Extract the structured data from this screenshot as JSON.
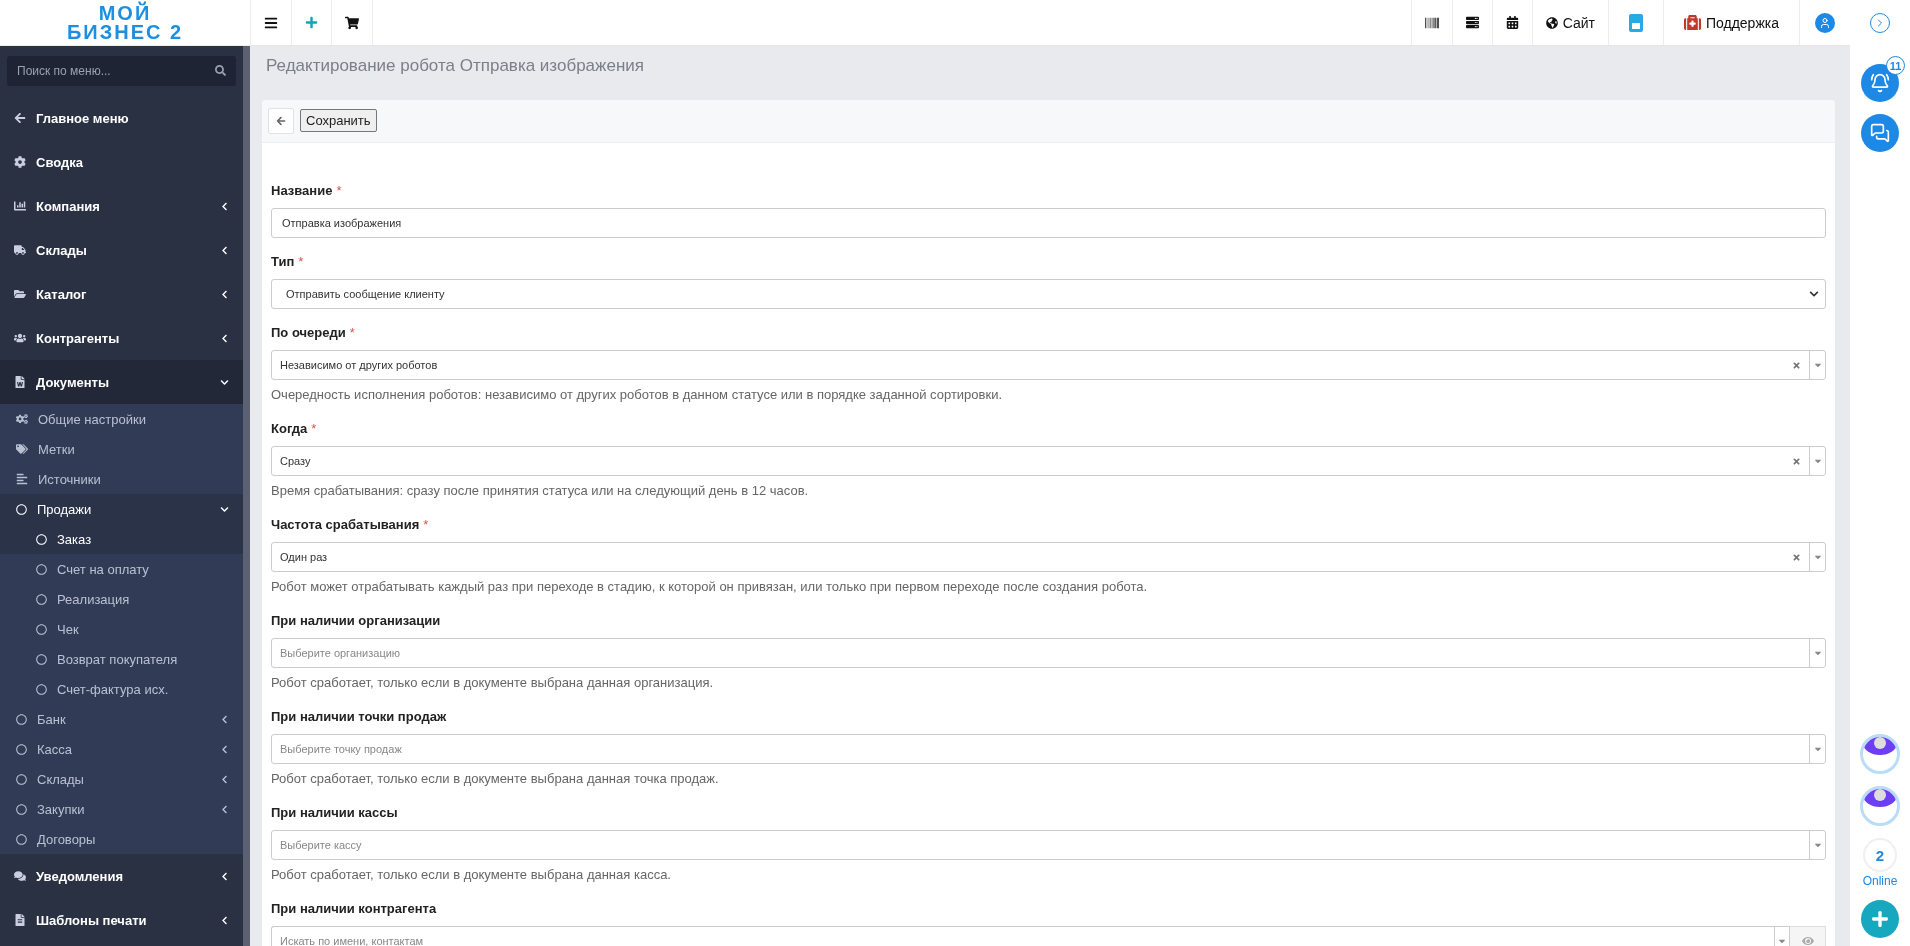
{
  "logo": {
    "line1": "МОЙ",
    "line2": "БИЗНЕС 2"
  },
  "topbar": {
    "site_label": "Сайт",
    "support_label": "Поддержка"
  },
  "sidebar": {
    "search_placeholder": "Поиск по меню...",
    "items": [
      {
        "label": "Главное меню",
        "kind": "link"
      },
      {
        "label": "Сводка",
        "kind": "link"
      },
      {
        "label": "Компания",
        "kind": "group",
        "expanded": false
      },
      {
        "label": "Склады",
        "kind": "group",
        "expanded": false
      },
      {
        "label": "Каталог",
        "kind": "group",
        "expanded": false
      },
      {
        "label": "Контрагенты",
        "kind": "group",
        "expanded": false
      },
      {
        "label": "Документы",
        "kind": "group",
        "expanded": true,
        "children": [
          {
            "label": "Общие настройки",
            "kind": "link"
          },
          {
            "label": "Метки",
            "kind": "link"
          },
          {
            "label": "Источники",
            "kind": "link"
          },
          {
            "label": "Продажи",
            "kind": "group",
            "expanded": true,
            "children": [
              {
                "label": "Заказ",
                "selected": true
              },
              {
                "label": "Счет на оплату",
                "selected": false
              },
              {
                "label": "Реализация",
                "selected": false
              },
              {
                "label": "Чек",
                "selected": false
              },
              {
                "label": "Возврат покупателя",
                "selected": false
              },
              {
                "label": "Счет-фактура исх.",
                "selected": false
              }
            ]
          },
          {
            "label": "Банк",
            "kind": "group",
            "expanded": false
          },
          {
            "label": "Касса",
            "kind": "group",
            "expanded": false
          },
          {
            "label": "Склады",
            "kind": "group",
            "expanded": false
          },
          {
            "label": "Закупки",
            "kind": "group",
            "expanded": false
          },
          {
            "label": "Договоры",
            "kind": "link"
          }
        ]
      },
      {
        "label": "Уведомления",
        "kind": "group",
        "expanded": false
      },
      {
        "label": "Шаблоны печати",
        "kind": "group",
        "expanded": false
      }
    ]
  },
  "page_title": "Редактирование робота Отправка изображения",
  "toolbar": {
    "save_label": "Сохранить"
  },
  "fields": [
    {
      "label": "Название",
      "mark": "*",
      "kind": "text",
      "value": "Отправка изображения"
    },
    {
      "label": "Тип",
      "mark": "*",
      "kind": "select",
      "value": "Отправить сообщение клиенту"
    },
    {
      "label": "По очереди",
      "mark": "*",
      "kind": "select2",
      "value": "Независимо от других роботов",
      "clearable": true,
      "help": "Очередность исполнения роботов: независимо от других роботов в данном статусе или в порядке заданной сортировки."
    },
    {
      "label": "Когда",
      "mark": "*",
      "kind": "select2",
      "value": "Сразу",
      "clearable": true,
      "help": "Время срабатывания: сразу после принятия статуса или на следующий день в 12 часов."
    },
    {
      "label": "Частота срабатывания",
      "mark": "*",
      "kind": "select2",
      "value": "Один раз",
      "clearable": true,
      "help": "Робот может отрабатывать каждый раз при переходе в стадию, к которой он привязан, или только при первом переходе после создания робота."
    },
    {
      "label": "При наличии организации",
      "kind": "select2",
      "placeholder": "Выберите организацию",
      "clearable": false,
      "help": "Робот сработает, только если в документе выбрана данная организация."
    },
    {
      "label": "При наличии точки продаж",
      "kind": "select2",
      "placeholder": "Выберите точку продаж",
      "clearable": false,
      "help": "Робот сработает, только если в документе выбрана данная точка продаж."
    },
    {
      "label": "При наличии кассы",
      "kind": "select2",
      "placeholder": "Выберите кассу",
      "clearable": false,
      "help": "Робот сработает, только если в документе выбрана данная касса."
    },
    {
      "label": "При наличии контрагента",
      "kind": "search",
      "placeholder": "Искать по имени, контактам"
    }
  ],
  "rail": {
    "notifications_count": "11",
    "online_count": "2",
    "online_label": "Online"
  }
}
